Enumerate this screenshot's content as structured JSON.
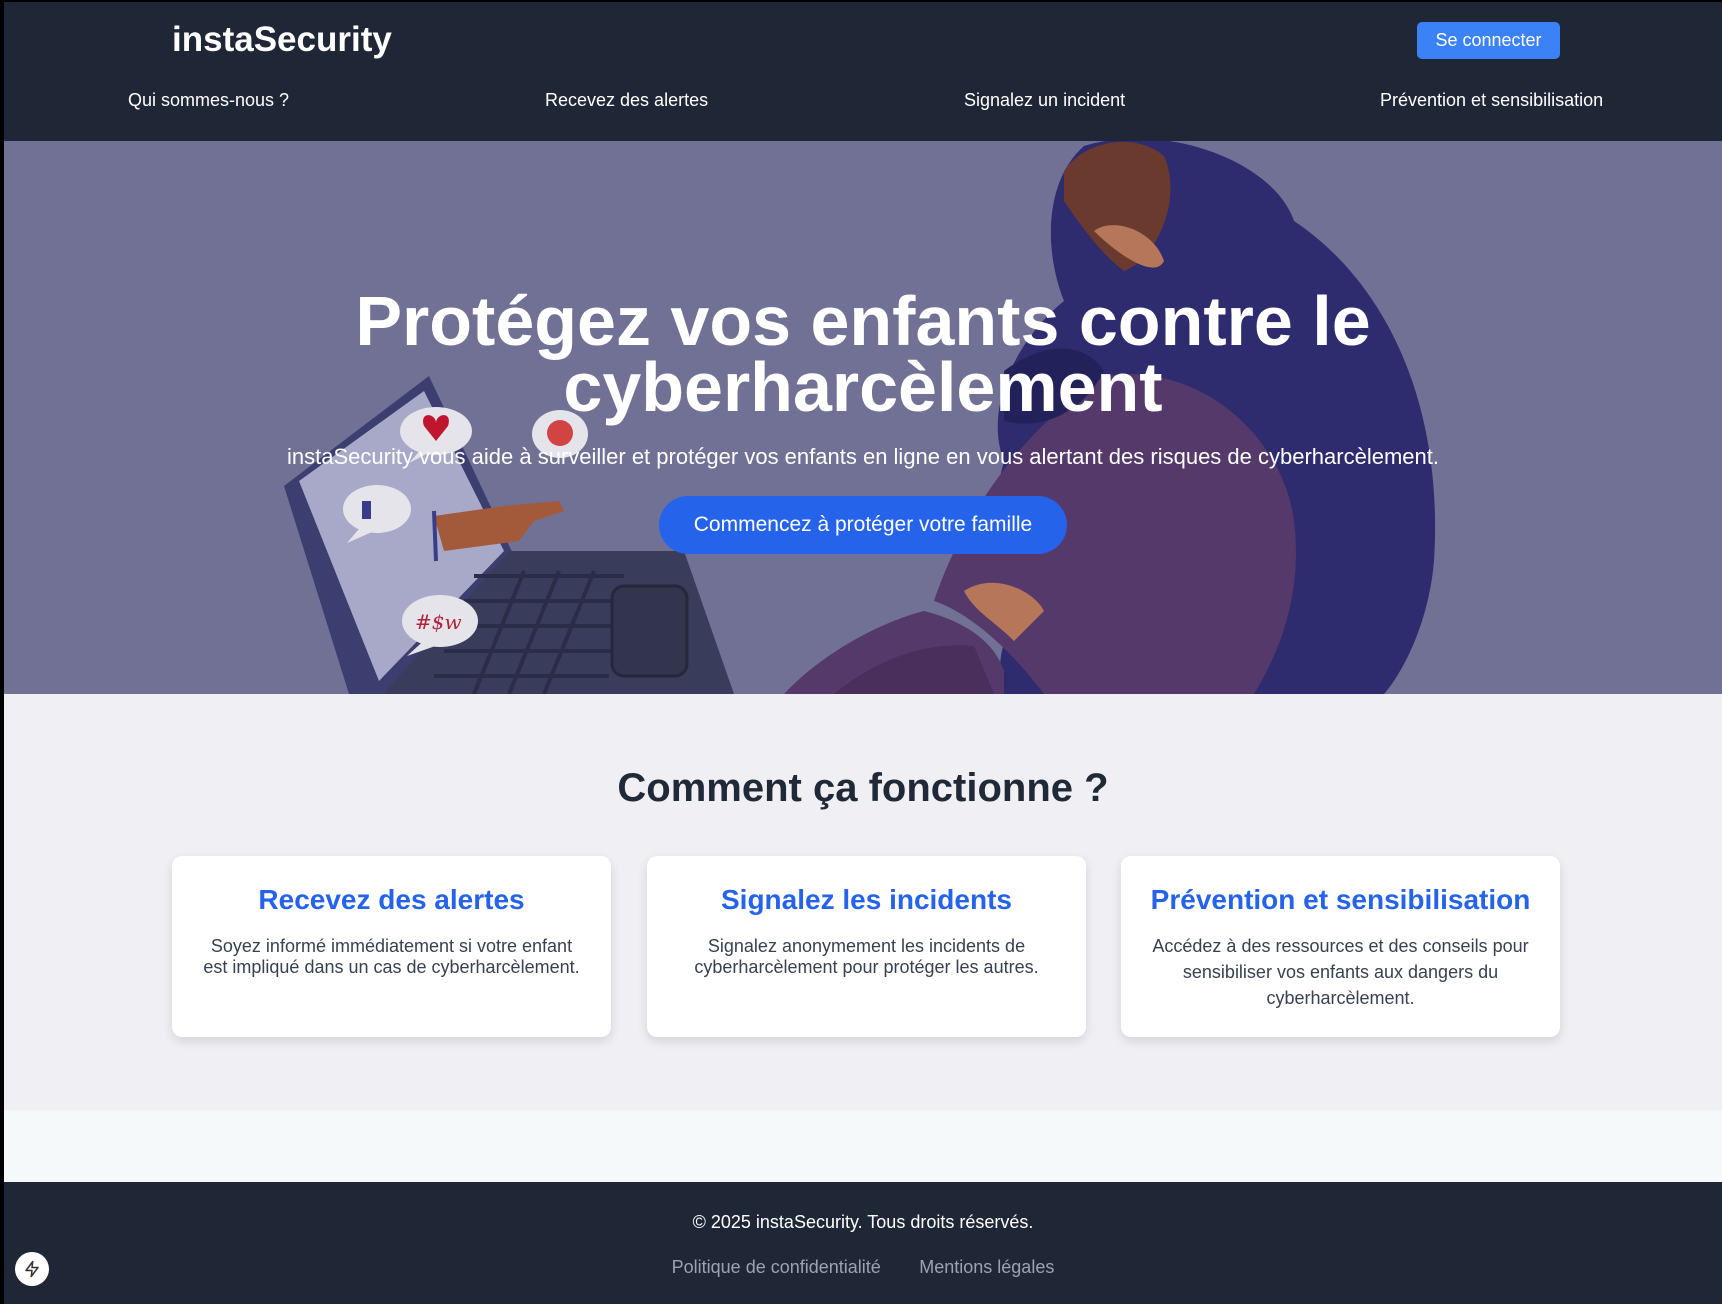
{
  "header": {
    "brand": "instaSecurity",
    "login_label": "Se connecter",
    "nav": [
      "Qui sommes-nous ?",
      "Recevez des alertes",
      "Signalez un incident",
      "Prévention et sensibilisation"
    ]
  },
  "hero": {
    "title": "Protégez vos enfants contre le cyberharcèlement",
    "subtitle": "instaSecurity vous aide à surveiller et protéger vos enfants en ligne en vous alertant des risques de cyberharcèlement.",
    "cta_label": "Commencez à protéger votre famille"
  },
  "how": {
    "title": "Comment ça fonctionne ?",
    "cards": [
      {
        "title": "Recevez des alertes",
        "text": "Soyez informé immédiatement si votre enfant est impliqué dans un cas de cyberharcèlement."
      },
      {
        "title": "Signalez les incidents",
        "text": "Signalez anonymement les incidents de cyberharcèlement pour protéger les autres."
      },
      {
        "title": "Prévention et sensibilisation",
        "text": "Accédez à des ressources et des conseils pour sensibiliser vos enfants aux dangers du cyberharcèlement."
      }
    ]
  },
  "illustration": {
    "bubble_text": "#$w"
  },
  "footer": {
    "copyright": "© 2025 instaSecurity. Tous droits réservés.",
    "links": [
      "Politique de confidentialité",
      "Mentions légales"
    ]
  },
  "icons": {
    "bolt": "lightning-bolt-icon"
  },
  "colors": {
    "header_bg": "#1f2736",
    "accent": "#3b82f6",
    "cta": "#2563eb",
    "hero_bg": "#717196"
  }
}
